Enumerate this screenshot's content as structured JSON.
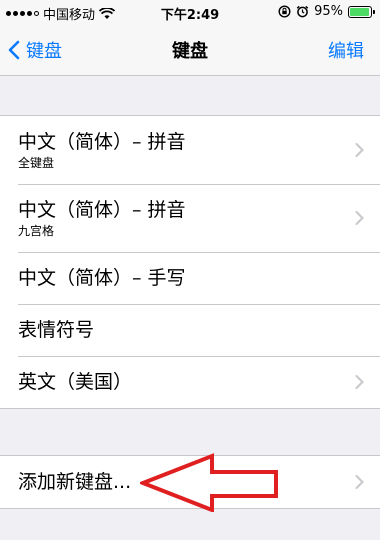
{
  "status_bar": {
    "carrier": "中国移动",
    "time": "下午2:49",
    "battery_percent": "95%",
    "battery_level": 0.95
  },
  "nav": {
    "back_label": "键盘",
    "title": "键盘",
    "edit_label": "编辑",
    "accent_color": "#0a7aff"
  },
  "keyboards": [
    {
      "title": "中文（简体）– 拼音",
      "subtitle": "全键盘",
      "has_chevron": true
    },
    {
      "title": "中文（简体）– 拼音",
      "subtitle": "九宫格",
      "has_chevron": true
    },
    {
      "title": "中文（简体）– 手写",
      "subtitle": "",
      "has_chevron": false
    },
    {
      "title": "表情符号",
      "subtitle": "",
      "has_chevron": false
    },
    {
      "title": "英文（美国）",
      "subtitle": "",
      "has_chevron": true
    }
  ],
  "add_keyboard": {
    "label": "添加新键盘..."
  },
  "annotation": {
    "arrow_color": "#e02020"
  }
}
